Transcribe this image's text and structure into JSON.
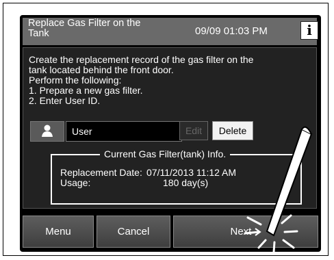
{
  "header": {
    "title": "Replace Gas Filter on the Tank",
    "datetime": "09/09 01:03 PM",
    "info_icon": "i"
  },
  "message": {
    "lines": [
      "Create the replacement record of the gas filter on the",
      "tank located behind the front door.",
      "Perform the following:",
      "1. Prepare a new gas filter.",
      "2. Enter User ID."
    ]
  },
  "user": {
    "field_value": "User",
    "icon": "person-icon"
  },
  "actions": {
    "edit_label": "Edit",
    "delete_label": "Delete"
  },
  "filter_info": {
    "title": "Current Gas Filter(tank) Info.",
    "replacement_date_label": "Replacement Date:",
    "replacement_date_value": "07/11/2013 11:12 AM",
    "usage_label": "Usage:",
    "usage_value": "180 day(s)"
  },
  "footer": {
    "menu_label": "Menu",
    "cancel_label": "Cancel",
    "next_label": "Next"
  }
}
